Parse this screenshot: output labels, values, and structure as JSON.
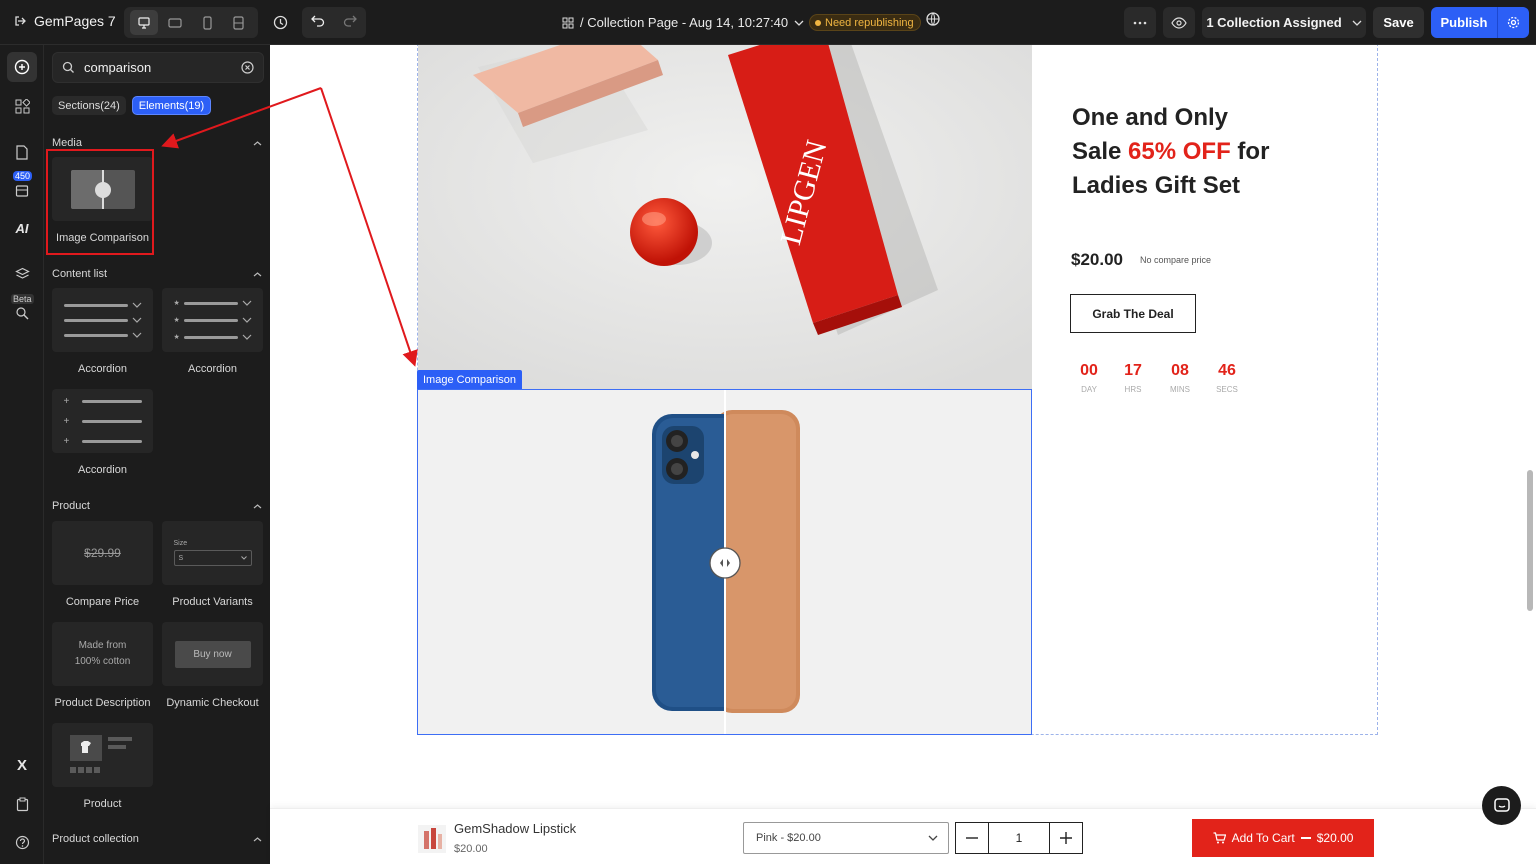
{
  "topbar": {
    "brand": "GemPages 7",
    "page_title": "/ Collection Page - Aug 14, 10:27:40",
    "status_badge": "Need republishing",
    "collection_button": "1 Collection Assigned",
    "save_label": "Save",
    "publish_label": "Publish"
  },
  "rail": {
    "count_badge": "450",
    "ai_label": "AI",
    "beta_label": "Beta",
    "x_label": "X"
  },
  "panel": {
    "search_value": "comparison",
    "tabs": [
      {
        "label": "Sections(24)"
      },
      {
        "label": "Elements(19)"
      }
    ],
    "categories": {
      "media": "Media",
      "content_list": "Content list",
      "product": "Product",
      "product_collection": "Product collection"
    },
    "media_items": [
      {
        "label": "Image Comparison"
      }
    ],
    "content_items": [
      {
        "label": "Accordion"
      },
      {
        "label": "Accordion"
      },
      {
        "label": "Accordion"
      }
    ],
    "product_items": [
      {
        "label": "Compare Price",
        "preview": "$29.99"
      },
      {
        "label": "Product Variants",
        "preview_label": "Size",
        "preview_value": "S"
      },
      {
        "label": "Product Description",
        "preview": "Made from 100% cotton"
      },
      {
        "label": "Dynamic Checkout",
        "preview": "Buy now"
      },
      {
        "label": "Product"
      }
    ]
  },
  "canvas": {
    "selection_label": "Image Comparison",
    "box_brand": "LIPGEN",
    "hero_title_part1": "One and Only",
    "hero_title_part2": "Sale ",
    "hero_title_highlight": "65% OFF",
    "hero_title_part3": " for",
    "hero_title_part4": "Ladies Gift Set",
    "price": "$20.00",
    "compare_note": "No compare price",
    "cta_label": "Grab The Deal",
    "countdown": [
      {
        "value": "00",
        "unit": "DAY"
      },
      {
        "value": "17",
        "unit": "HRS"
      },
      {
        "value": "08",
        "unit": "MINS"
      },
      {
        "value": "46",
        "unit": "SECS"
      }
    ],
    "accent_color": "#e2231a"
  },
  "sticky_cart": {
    "product_name": "GemShadow Lipstick",
    "product_price": "$20.00",
    "variant_selected": "Pink - $20.00",
    "quantity": "1",
    "add_to_cart_label": "Add To Cart",
    "add_to_cart_price": "$20.00"
  }
}
